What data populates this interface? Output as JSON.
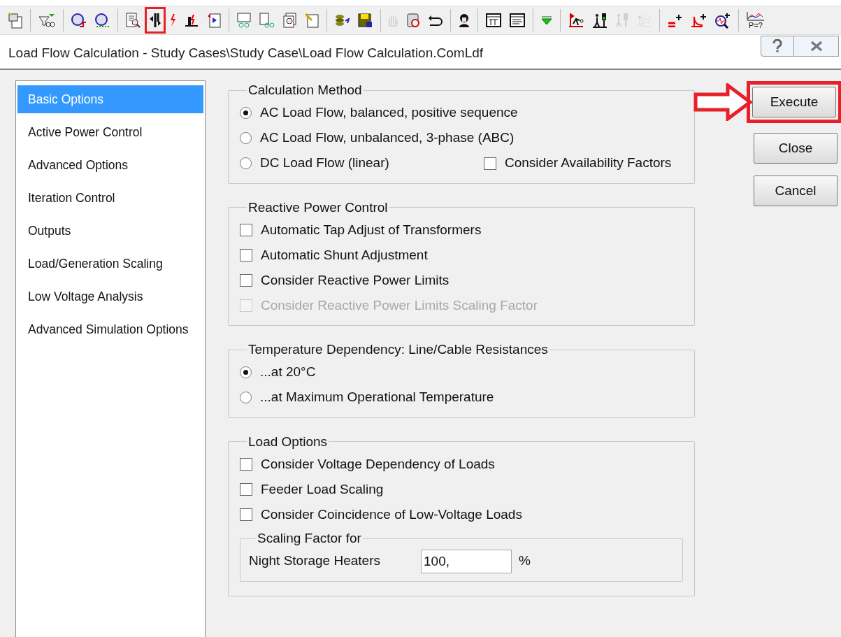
{
  "toolbar": {
    "groups": [
      [
        {
          "highlighted": false,
          "disabled": false
        }
      ],
      [
        {
          "highlighted": false,
          "disabled": false
        }
      ],
      [
        {
          "highlighted": false,
          "disabled": false
        },
        {
          "highlighted": false,
          "disabled": false
        }
      ],
      [
        {
          "highlighted": false,
          "disabled": false
        },
        {
          "highlighted": true,
          "disabled": false
        },
        {
          "highlighted": false,
          "disabled": false
        },
        {
          "highlighted": false,
          "disabled": false
        },
        {
          "highlighted": false,
          "disabled": false
        }
      ],
      [
        {
          "highlighted": false,
          "disabled": false
        },
        {
          "highlighted": false,
          "disabled": false
        },
        {
          "highlighted": false,
          "disabled": false
        },
        {
          "highlighted": false,
          "disabled": false
        }
      ],
      [
        {
          "highlighted": false,
          "disabled": false
        },
        {
          "highlighted": false,
          "disabled": false
        }
      ],
      [
        {
          "highlighted": false,
          "disabled": true
        },
        {
          "highlighted": false,
          "disabled": false
        },
        {
          "highlighted": false,
          "disabled": false
        }
      ],
      [
        {
          "highlighted": false,
          "disabled": false
        }
      ],
      [
        {
          "highlighted": false,
          "disabled": false
        },
        {
          "highlighted": false,
          "disabled": false
        }
      ],
      [
        {
          "highlighted": false,
          "disabled": false
        }
      ],
      [
        {
          "highlighted": false,
          "disabled": false
        },
        {
          "highlighted": false,
          "disabled": false
        },
        {
          "highlighted": false,
          "disabled": true
        },
        {
          "highlighted": false,
          "disabled": true
        }
      ],
      [
        {
          "highlighted": false,
          "disabled": false
        },
        {
          "highlighted": false,
          "disabled": false
        },
        {
          "highlighted": false,
          "disabled": false
        }
      ],
      [
        {
          "highlighted": false,
          "disabled": false,
          "text": "P=?"
        }
      ]
    ]
  },
  "window": {
    "title": "Load Flow Calculation - Study Cases\\Study Case\\Load Flow Calculation.ComLdf"
  },
  "sidebar": {
    "items": [
      {
        "label": "Basic Options",
        "selected": true
      },
      {
        "label": "Active Power Control",
        "selected": false
      },
      {
        "label": "Advanced Options",
        "selected": false
      },
      {
        "label": "Iteration Control",
        "selected": false
      },
      {
        "label": "Outputs",
        "selected": false
      },
      {
        "label": "Load/Generation Scaling",
        "selected": false
      },
      {
        "label": "Low Voltage Analysis",
        "selected": false
      },
      {
        "label": "Advanced Simulation Options",
        "selected": false
      }
    ]
  },
  "groups": [
    {
      "title": "Calculation Method",
      "items": [
        {
          "kind": "radio",
          "label": "AC Load Flow, balanced, positive sequence",
          "selected": true,
          "disabled": false
        },
        {
          "kind": "radio",
          "label": "AC Load Flow, unbalanced, 3-phase (ABC)",
          "selected": false,
          "disabled": false
        },
        {
          "kind": "radio",
          "label": "DC Load Flow (linear)",
          "selected": false,
          "disabled": false,
          "beside": {
            "kind": "checkbox",
            "label": "Consider Availability Factors",
            "checked": false,
            "disabled": false
          }
        }
      ]
    },
    {
      "title": "Reactive Power Control",
      "items": [
        {
          "kind": "checkbox",
          "label": "Automatic Tap Adjust of Transformers",
          "checked": false,
          "disabled": false
        },
        {
          "kind": "checkbox",
          "label": "Automatic Shunt Adjustment",
          "checked": false,
          "disabled": false
        },
        {
          "kind": "checkbox",
          "label": "Consider Reactive Power Limits",
          "checked": false,
          "disabled": false
        },
        {
          "kind": "checkbox",
          "label": "Consider Reactive Power Limits Scaling Factor",
          "checked": false,
          "disabled": true
        }
      ]
    },
    {
      "title": "Temperature Dependency: Line/Cable Resistances",
      "items": [
        {
          "kind": "radio",
          "label": "...at 20°C",
          "selected": true,
          "disabled": false
        },
        {
          "kind": "radio",
          "label": "...at Maximum Operational Temperature",
          "selected": false,
          "disabled": false
        }
      ]
    },
    {
      "title": "Load Options",
      "items": [
        {
          "kind": "checkbox",
          "label": "Consider Voltage Dependency of Loads",
          "checked": false,
          "disabled": false
        },
        {
          "kind": "checkbox",
          "label": "Feeder Load Scaling",
          "checked": false,
          "disabled": false
        },
        {
          "kind": "checkbox",
          "label": "Consider Coincidence of Low-Voltage Loads",
          "checked": false,
          "disabled": false
        }
      ],
      "subgroup": {
        "title": "Scaling Factor for",
        "field": {
          "label": "Night Storage Heaters",
          "value": "100,",
          "unit": "%"
        }
      }
    }
  ],
  "buttons": [
    {
      "label": "Execute",
      "highlighted": true
    },
    {
      "label": "Close",
      "highlighted": false
    },
    {
      "label": "Cancel",
      "highlighted": false
    }
  ]
}
